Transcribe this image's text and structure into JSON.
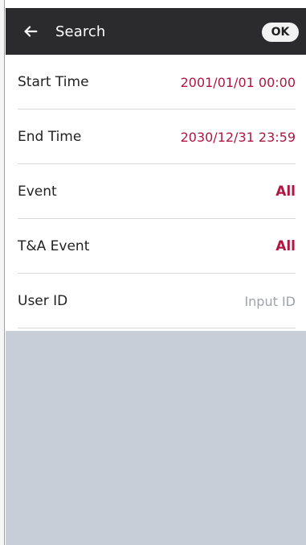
{
  "header": {
    "title": "Search",
    "ok_label": "OK"
  },
  "rows": [
    {
      "label": "Start Time",
      "value": "2001/01/01 00:00"
    },
    {
      "label": "End Time",
      "value": "2030/12/31 23:59"
    },
    {
      "label": "Event",
      "value": "All"
    },
    {
      "label": "T&A Event",
      "value": "All"
    },
    {
      "label": "User ID",
      "placeholder": "Input ID"
    }
  ],
  "icons": {
    "back": "back-arrow-icon"
  },
  "colors": {
    "header_bg": "#2b2b2e",
    "value_text": "#ad1741",
    "placeholder_text": "#9ea3aa",
    "empty_area": "#c8ced8"
  }
}
